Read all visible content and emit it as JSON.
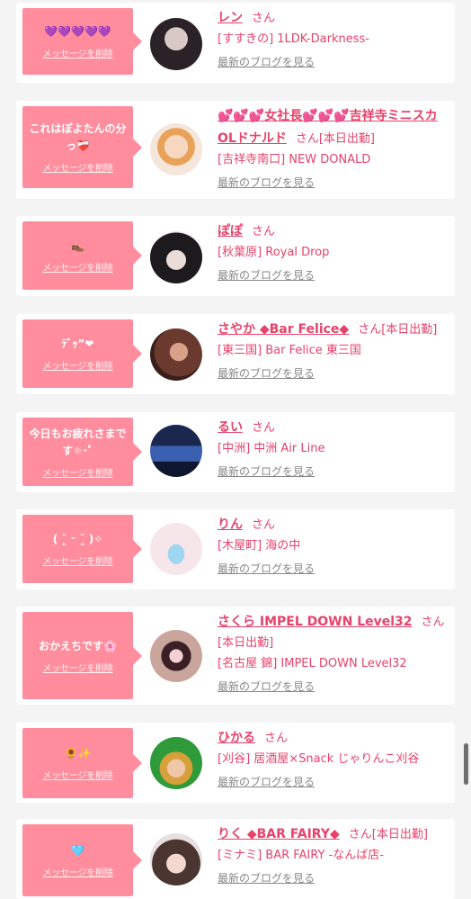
{
  "colors": {
    "accent": "#e8426a",
    "bubble": "#ff8d9d",
    "blog_link": "#888888"
  },
  "common": {
    "delete_label": "メッセージを削除",
    "blog_label": "最新のブログを見る",
    "san_label": "さん"
  },
  "cards": [
    {
      "message": "💜💜💜💜💜",
      "name": "レン",
      "today": "",
      "shop": "[すすきの] 1LDK-Darkness-",
      "avatar_icon": "avatar-photo"
    },
    {
      "message": "これはぽよたんの分っ❤️‍🩹",
      "name": "💕💕💕女社長💕💕💕吉祥寺ミニスカOLドナルド",
      "today": "[本日出勤]",
      "shop": "[吉祥寺南口] NEW DONALD",
      "avatar_icon": "avatar-illustration"
    },
    {
      "message": "👞",
      "name": "ぽぽ",
      "today": "",
      "shop": "[秋葉原] Royal Drop",
      "avatar_icon": "avatar-photo"
    },
    {
      "message": "ﾃﾞｯ”❤︎",
      "name": "さやか ◆Bar Felice◆",
      "today": "[本日出勤]",
      "shop": "[東三国] Bar Felice 東三国",
      "avatar_icon": "avatar-photo"
    },
    {
      "message": "今日もお疲れさまです☼･ﾟ",
      "name": "るい",
      "today": "",
      "shop": "[中洲] 中洲 Air Line",
      "avatar_icon": "avatar-photo"
    },
    {
      "message": "( ˘͈ ᵕ ˘͈ )✧",
      "name": "りん",
      "today": "",
      "shop": "[木屋町] 海の中",
      "avatar_icon": "avatar-photo"
    },
    {
      "message": "おかえちです🌸",
      "name": "さくら IMPEL DOWN Level32",
      "today": "[本日出勤]",
      "shop": "[名古屋 錦] IMPEL DOWN Level32",
      "avatar_icon": "avatar-photo"
    },
    {
      "message": "🌻✨",
      "name": "ひかる",
      "today": "",
      "shop": "[刈谷] 居酒屋×Snack じゃりんこ刈谷",
      "avatar_icon": "avatar-photo"
    },
    {
      "message": "🩵",
      "name": "りく ◆BAR FAIRY◆",
      "today": "[本日出勤]",
      "shop": "[ミナミ] BAR FAIRY -なんば店-",
      "avatar_icon": "avatar-photo"
    }
  ]
}
